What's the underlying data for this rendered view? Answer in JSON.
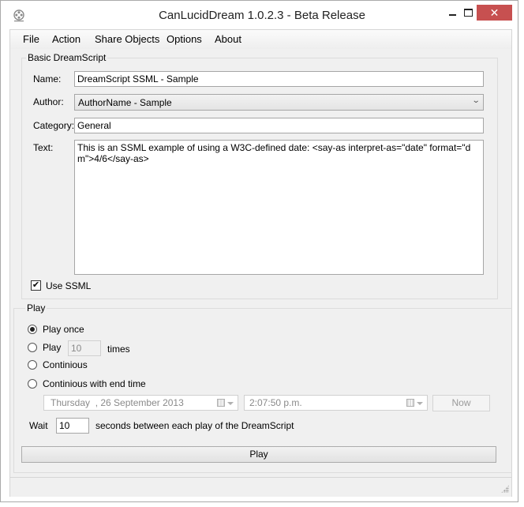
{
  "window": {
    "title": "CanLucidDream 1.0.2.3 - Beta Release",
    "app_icon": "film-reel-icon",
    "controls": {
      "minimize": "minimize-icon",
      "maximize": "maximize-icon",
      "close_glyph": "✕"
    },
    "close_color": "#c75050"
  },
  "menu": {
    "items": [
      {
        "label": "File"
      },
      {
        "label": "Action"
      },
      {
        "label": "Share Objects"
      },
      {
        "label": "Options"
      },
      {
        "label": "About"
      }
    ]
  },
  "basic": {
    "group_label": "Basic DreamScript",
    "name_label": "Name:",
    "name_value": "DreamScript SSML - Sample",
    "author_label": "Author:",
    "author_value": "AuthorName - Sample",
    "category_label": "Category:",
    "category_value": "General",
    "text_label": "Text:",
    "text_value": "This is an SSML example of using a W3C-defined date: <say-as interpret-as=\"date\" format=\"dm\">4/6</say-as>",
    "use_ssml_label": "Use SSML",
    "use_ssml_checked": true
  },
  "play": {
    "group_label": "Play",
    "options": [
      {
        "label": "Play once",
        "checked": true
      },
      {
        "label": "Play",
        "checked": false
      },
      {
        "label": "Continious",
        "checked": false
      },
      {
        "label": "Continious with end time",
        "checked": false
      }
    ],
    "times_value": "10",
    "times_label": "times",
    "date_value": "Thursday  , 26 September 2013",
    "time_value": "2:07:50 p.m.",
    "now_label": "Now",
    "wait_label": "Wait",
    "wait_value": "10",
    "wait_suffix": "seconds between each play of the DreamScript",
    "play_button": "Play"
  }
}
